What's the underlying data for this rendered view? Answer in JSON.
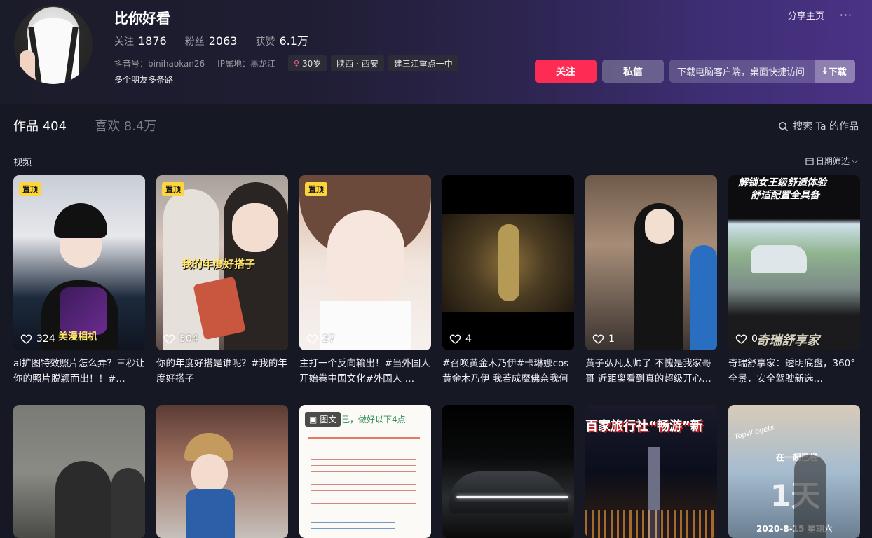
{
  "profile": {
    "name": "比你好看",
    "following_label": "关注",
    "following": "1876",
    "followers_label": "粉丝",
    "followers": "2063",
    "likes_label": "获赞",
    "likes": "6.1万",
    "douyin_id": "抖音号：binihaokan26",
    "ip": "IP属地：黑龙江",
    "tags": [
      "30岁",
      "陕西 · 西安",
      "建三江重点一中"
    ],
    "bio": "多个朋友多条路"
  },
  "topbar": {
    "share": "分享主页",
    "more": "···"
  },
  "actions": {
    "follow": "关注",
    "message": "私信",
    "download_text": "下载电脑客户端，桌面快捷访问",
    "download_btn": "下载"
  },
  "tabs": [
    {
      "label": "作品 404",
      "active": true
    },
    {
      "label": "喜欢 8.4万",
      "active": false
    }
  ],
  "search_placeholder": "搜索 Ta 的作品",
  "section": "视频",
  "date_filter": "日期筛选",
  "pinned_label": "置顶",
  "post_label": "图文",
  "videos": [
    {
      "likes": "324",
      "title": "ai扩图特效照片怎么弄？三秒让你的照片脱颖而出！！#…",
      "overlay": "美漫相机"
    },
    {
      "likes": "504",
      "title": "你的年度好搭是谁呢？#我的年度好搭子",
      "overlay": "我的年度好搭子"
    },
    {
      "likes": "27",
      "title": "主打一个反向输出！#当外国人开始卷中国文化#外国人 …"
    },
    {
      "likes": "4",
      "title": "#召唤黄金木乃伊#卡琳娜cos黄金木乃伊 我若成魔佛奈我何"
    },
    {
      "likes": "1",
      "title": "黄子弘凡太帅了 不愧是我家哥哥 近距离看到真的超级开心…"
    },
    {
      "likes": "0",
      "title": "奇瑞舒享家：透明底盘，360°全景，安全驾驶新选…",
      "overlay_top": "解锁女王级舒适体验",
      "overlay_top2": "舒适配置全具备",
      "overlay_bottom": "奇瑞舒享家"
    }
  ],
  "row2": [
    {
      "name": "outdoor"
    },
    {
      "name": "child"
    },
    {
      "name": "note",
      "overlay": "己，做好以下4点"
    },
    {
      "name": "car-dark"
    },
    {
      "name": "night-city",
      "overlay": "百家旅行社“畅游”新"
    },
    {
      "name": "widget",
      "overlay_tag": "TopWidgets",
      "overlay_line": "在一起已经",
      "overlay_big": "1天",
      "overlay_date": "2020-8-15 星期六"
    }
  ]
}
